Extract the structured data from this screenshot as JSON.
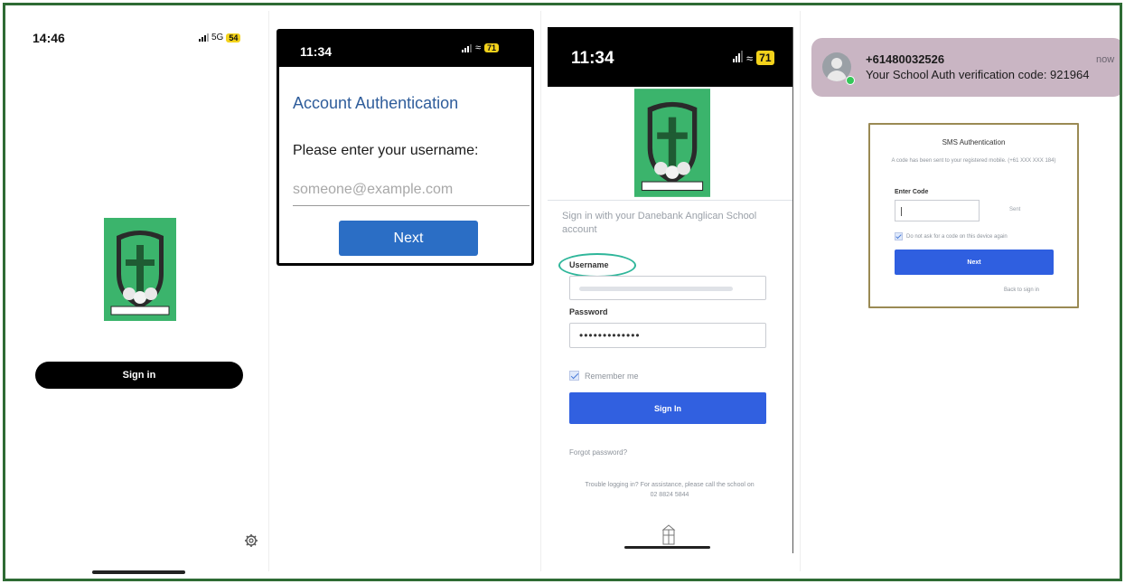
{
  "panel1": {
    "time": "14:46",
    "network": "5G",
    "battery": "54",
    "sign_in_label": "Sign in",
    "icons": {
      "settings": "gear-icon",
      "crest": "school-crest-logo"
    }
  },
  "panel2": {
    "time": "11:34",
    "battery": "71",
    "title": "Account Authentication",
    "prompt": "Please enter your username:",
    "username_placeholder": "someone@example.com",
    "next_label": "Next"
  },
  "panel3": {
    "time": "11:34",
    "battery": "71",
    "intro": "Sign in with your Danebank Anglican School account",
    "username_label": "Username",
    "password_label": "Password",
    "password_value": "•••••••••••••",
    "remember_label": "Remember me",
    "sign_in_label": "Sign In",
    "forgot_label": "Forgot password?",
    "help_text": "Trouble logging in? For assistance, please call the school on 02 8824 5844"
  },
  "panel4": {
    "notification": {
      "sender": "+61480032526",
      "time": "now",
      "message": "Your School Auth verification code: 921964"
    },
    "card": {
      "title": "SMS Authentication",
      "subtitle": "A code has been sent to your registered mobile. (+61 XXX XXX 184)",
      "code_label": "Enter Code",
      "sent_label": "Sent",
      "remember_label": "Do not ask for a code on this device again",
      "next_label": "Next",
      "back_label": "Back to sign in"
    }
  },
  "colors": {
    "frame_green": "#2e6b34",
    "crest_green": "#3bb46c",
    "link_blue": "#2b6ec5",
    "signin_blue": "#3160e0",
    "highlight_teal": "#2fb69a",
    "battery_yellow": "#f3d21b"
  }
}
